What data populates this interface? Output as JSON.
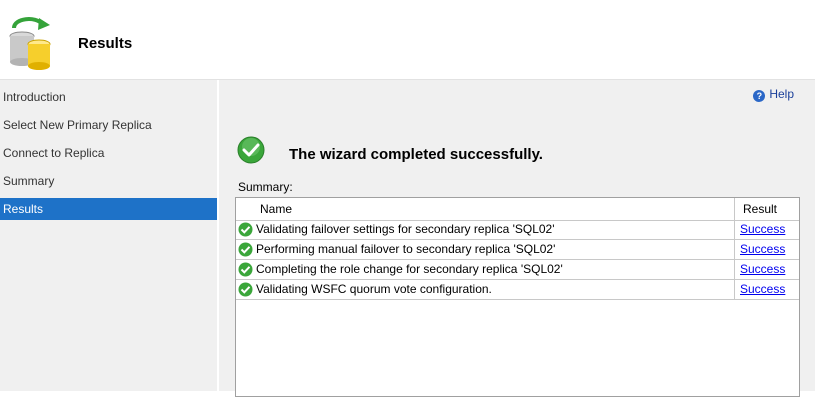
{
  "header": {
    "title": "Results"
  },
  "sidebar": {
    "items": [
      {
        "label": "Introduction",
        "active": false
      },
      {
        "label": "Select New Primary Replica",
        "active": false
      },
      {
        "label": "Connect to Replica",
        "active": false
      },
      {
        "label": "Summary",
        "active": false
      },
      {
        "label": "Results",
        "active": true
      }
    ]
  },
  "main": {
    "help_label": "Help",
    "status_message": "The wizard completed successfully.",
    "summary_label": "Summary:",
    "table": {
      "columns": [
        "Name",
        "Result"
      ],
      "rows": [
        {
          "name": "Validating failover settings for secondary replica 'SQL02'",
          "result": "Success"
        },
        {
          "name": "Performing manual failover to secondary replica 'SQL02'",
          "result": "Success"
        },
        {
          "name": "Completing the role change for secondary replica 'SQL02'",
          "result": "Success"
        },
        {
          "name": "Validating WSFC quorum vote configuration.",
          "result": "Success"
        }
      ]
    }
  },
  "colors": {
    "selection": "#1e72c8",
    "panel": "#f0f0f0",
    "link": "#0000ee",
    "success": "#3aa63a"
  }
}
